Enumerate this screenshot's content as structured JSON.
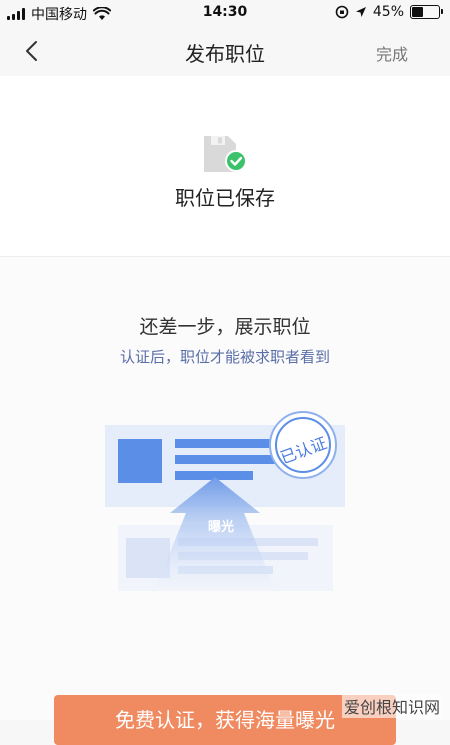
{
  "status_bar": {
    "carrier": "中国移动",
    "time": "14:30",
    "battery_percent": "45%",
    "battery_level": 0.45,
    "icons": [
      "signal-icon",
      "wifi-icon",
      "rotation-lock-icon",
      "location-icon",
      "battery-icon"
    ]
  },
  "nav": {
    "title": "发布职位",
    "done_label": "完成",
    "back_icon": "chevron-left-icon"
  },
  "saved": {
    "icon": "document-saved-icon",
    "text": "职位已保存"
  },
  "promo": {
    "title": "还差一步，展示职位",
    "subtitle": "认证后，职位才能被求职者看到",
    "exposure_label": "曝光",
    "stamp_label": "已认证"
  },
  "cta": {
    "label": "免费认证，获得海量曝光"
  },
  "watermark": "爱创根知识网",
  "colors": {
    "accent": "#f08a60",
    "blue": "#5b8ee6",
    "check_green": "#3cc26a"
  }
}
